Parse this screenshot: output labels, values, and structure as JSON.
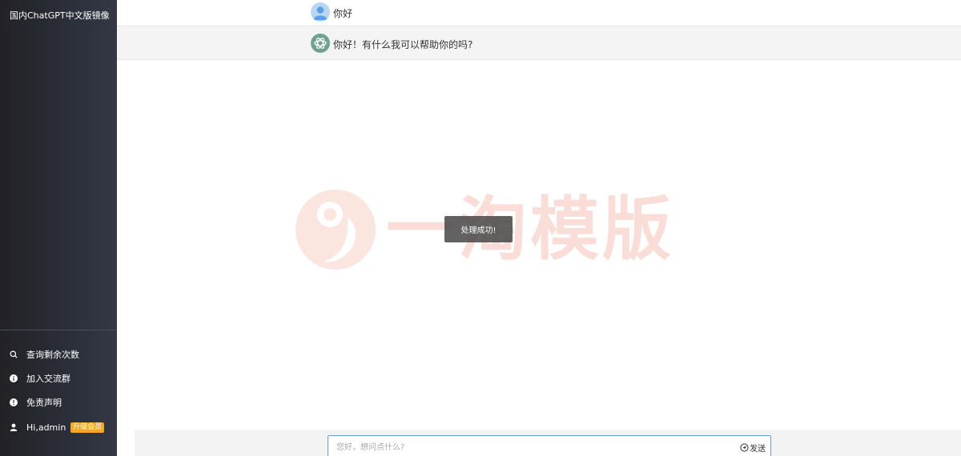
{
  "sidebar": {
    "brand": "国内ChatGPT中文版镜像",
    "items": [
      {
        "label": "查询剩余次数",
        "icon": "search-icon"
      },
      {
        "label": "加入交流群",
        "icon": "info-icon"
      },
      {
        "label": "免责声明",
        "icon": "alert-icon"
      },
      {
        "label": "Hi,admin",
        "icon": "user-icon",
        "badge": "升级会员"
      }
    ]
  },
  "messages": [
    {
      "role": "user",
      "text": "你好",
      "avatar": "user-avatar-icon"
    },
    {
      "role": "assistant",
      "text": "你好！有什么我可以帮助你的吗?",
      "avatar": "openai-logo-icon"
    }
  ],
  "watermark": {
    "text": "一淘模版"
  },
  "toast": {
    "text": "处理成功!"
  },
  "composer": {
    "placeholder": "您好，想问点什么?",
    "send_label": "发送",
    "send_icon": "send-icon"
  },
  "colors": {
    "sidebar_bg": "#2b2f39",
    "badge": "#f5a623",
    "input_border": "#6a9ec9",
    "watermark": "#f9ddd6"
  }
}
